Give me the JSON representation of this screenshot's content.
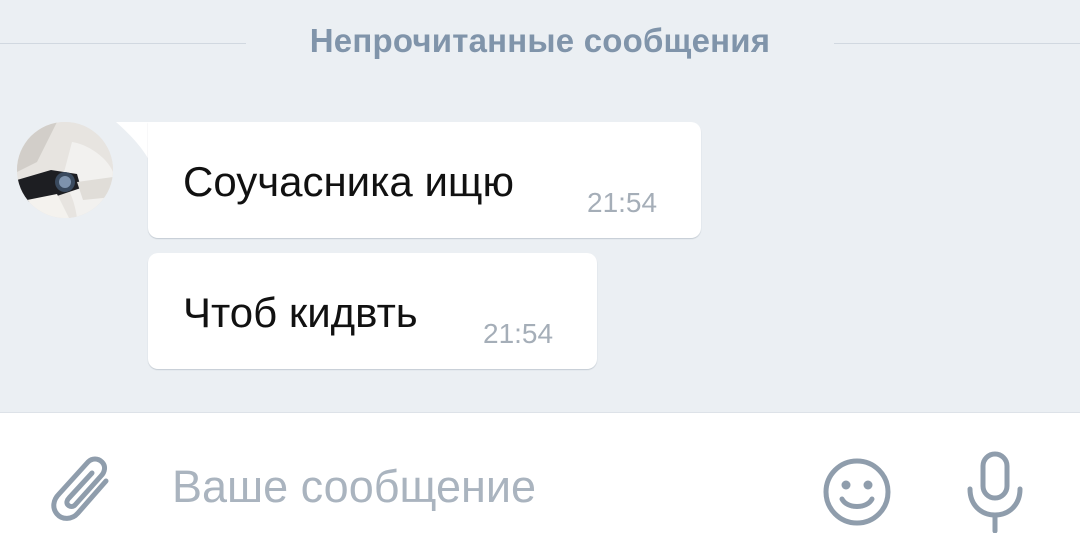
{
  "chat": {
    "unread_divider": "Непрочитанные сообщения",
    "messages": [
      {
        "text": "Соучасника ищю",
        "time": "21:54"
      },
      {
        "text": "Чтоб кидвть",
        "time": "21:54"
      }
    ]
  },
  "composer": {
    "placeholder": "Ваше сообщение",
    "value": ""
  },
  "icons": {
    "attach": "paperclip-icon",
    "emoji": "smiley-icon",
    "voice": "microphone-icon"
  },
  "colors": {
    "chat_background": "#ebeff3",
    "divider_text": "#8094aa",
    "bubble": "#ffffff",
    "timestamp": "#a5aeb8",
    "icon": "#8f9dac"
  }
}
